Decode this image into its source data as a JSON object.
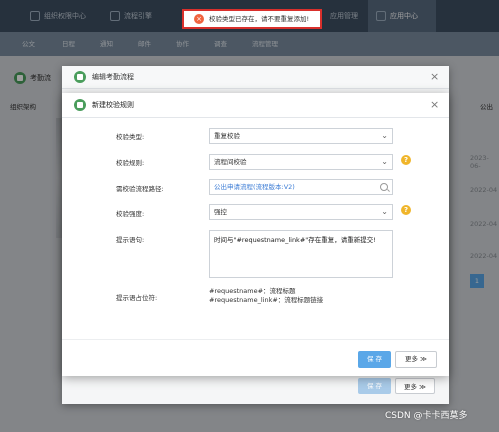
{
  "toast": {
    "message": "校验类型已存在，请不要重复添加!"
  },
  "topnav": {
    "tabs": [
      {
        "label": "组织权限中心"
      },
      {
        "label": "流程引擎"
      },
      {
        "label": "应用管理"
      },
      {
        "label": "应用中心"
      }
    ]
  },
  "subnav": {
    "items": [
      "公文",
      "日程",
      "通知",
      "邮件",
      "协作",
      "调查",
      "流程管理"
    ]
  },
  "background": {
    "title": "考勤流",
    "org_label": "组织架构",
    "public_label": "公出",
    "dates": [
      "2023-06-",
      "2022-04",
      "2022-04",
      "2022-04"
    ],
    "page": "1"
  },
  "outer_modal": {
    "title": "编辑考勤流程",
    "save_label": "保 存",
    "more_label": "更多"
  },
  "inner_modal": {
    "title": "新建校验规则",
    "fields": {
      "check_type": {
        "label": "校验类型:",
        "value": "重复校验"
      },
      "check_rule": {
        "label": "校验规则:",
        "value": "流程间校验"
      },
      "flow_path": {
        "label": "需校验流程路径:",
        "value": "公出申请流程(流程版本:V2)"
      },
      "strength": {
        "label": "校验强度:",
        "value": "强控"
      },
      "prompt": {
        "label": "提示语句:",
        "value": "时间与\"#requestname_link#\"存在重复，请重新提交!"
      },
      "placeholder_label": "提示语占位符:",
      "placeholders": [
        "#requestname#：流程标题",
        "#requestname_link#：流程标题链接"
      ]
    },
    "save_label": "保 存",
    "more_label": "更多"
  },
  "watermark": "CSDN @卡卡西莫多",
  "colors": {
    "primary": "#5aa7e8",
    "toast_border": "#d9302c",
    "help": "#f0b52b",
    "link": "#3a7bd5"
  }
}
